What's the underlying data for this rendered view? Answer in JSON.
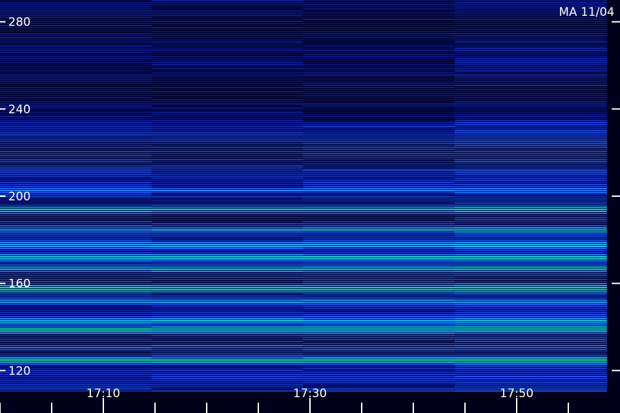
{
  "chart_data": {
    "type": "heatmap",
    "title": "MA 11/04",
    "y_ticks": [
      120,
      160,
      200,
      240,
      280
    ],
    "x_ticks": [
      "17:10",
      "17:30",
      "17:50"
    ],
    "ylim": [
      110,
      290
    ],
    "grid": false,
    "colormap": [
      "#000014",
      "#0a1a8c",
      "#1e5aff",
      "#00c8ff",
      "#00ff9a"
    ],
    "bright_bands": [
      {
        "center": 125,
        "level": 0.95
      },
      {
        "center": 131,
        "level": 0.55
      },
      {
        "center": 139,
        "level": 0.95
      },
      {
        "center": 143,
        "level": 0.85
      },
      {
        "center": 152,
        "level": 0.7
      },
      {
        "center": 158,
        "level": 0.95
      },
      {
        "center": 167,
        "level": 0.85
      },
      {
        "center": 172,
        "level": 0.9
      },
      {
        "center": 178,
        "level": 0.8
      },
      {
        "center": 185,
        "level": 0.75
      },
      {
        "center": 194,
        "level": 0.8
      },
      {
        "center": 203,
        "level": 0.6
      },
      {
        "center": 212,
        "level": 0.45
      }
    ]
  }
}
